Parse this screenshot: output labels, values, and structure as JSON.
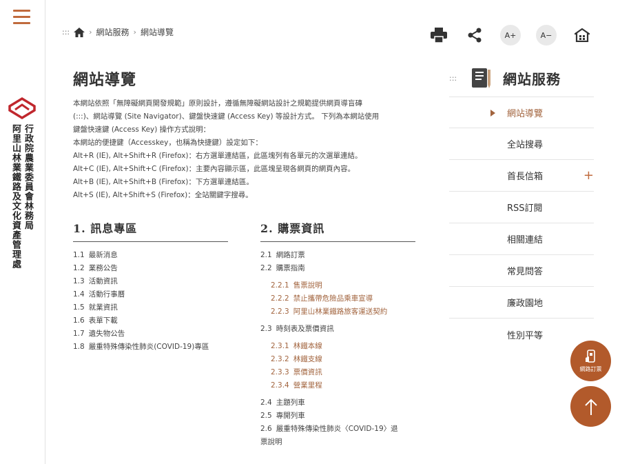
{
  "org": {
    "col1": "行政院農業委員會林務局",
    "col2": "阿里山林業鐵路及文化資產管理處"
  },
  "breadcrumb": {
    "dots": ":::",
    "items": [
      "網站服務",
      "網站導覽"
    ]
  },
  "toolbar": {
    "font_up": "A+",
    "font_down": "A−"
  },
  "page": {
    "title": "網站導覽",
    "intro": [
      "本網站依照「無障礙網頁開發規範」原則設計，遵循無障礙網站設計之規範提供網頁導盲磚",
      "(:::)、網站導覽 (Site Navigator)、鍵盤快速鍵 (Access Key) 等設計方式。 下列為本網站使用",
      "鍵盤快速鍵 (Access Key) 操作方式說明：",
      "本網站的便捷鍵（Accesskey，也稱為快捷鍵）設定如下：",
      "Alt+R (IE), Alt+Shift+R (Firefox)：右方選單連結區，此區塊列有各單元的次選單連結。",
      "Alt+C (IE), Alt+Shift+C (Firefox)：主要內容顯示區，此區塊呈現各網頁的網頁內容。",
      "Alt+B (IE), Alt+Shift+B (Firefox)：下方選單連結區。",
      "Alt+S (IE), Alt+Shift+S (Firefox)：全站關鍵字搜尋。"
    ]
  },
  "sections": [
    {
      "title": "1. 訊息專區",
      "items": [
        {
          "num": "1.1",
          "label": "最新消息"
        },
        {
          "num": "1.2",
          "label": "業務公告"
        },
        {
          "num": "1.3",
          "label": "活動資訊"
        },
        {
          "num": "1.4",
          "label": "活動行事曆"
        },
        {
          "num": "1.5",
          "label": "就業資訊"
        },
        {
          "num": "1.6",
          "label": "表單下載"
        },
        {
          "num": "1.7",
          "label": "遺失物公告"
        },
        {
          "num": "1.8",
          "label": "嚴重特殊傳染性肺炎(COVID-19)專區"
        }
      ]
    },
    {
      "title": "2. 購票資訊",
      "items": [
        {
          "num": "2.1",
          "label": "網路訂票"
        },
        {
          "num": "2.2",
          "label": "購票指南"
        },
        {
          "num": "2.2.1",
          "label": "售票說明"
        },
        {
          "num": "2.2.2",
          "label": "禁止攜帶危險品乘車宣導"
        },
        {
          "num": "2.2.3",
          "label": "阿里山林業鐵路旅客運送契約"
        },
        {
          "num": "2.3",
          "label": "時刻表及票價資訊"
        },
        {
          "num": "2.3.1",
          "label": "林鐵本線"
        },
        {
          "num": "2.3.2",
          "label": "林鐵支線"
        },
        {
          "num": "2.3.3",
          "label": "票價資訊"
        },
        {
          "num": "2.3.4",
          "label": "營業里程"
        },
        {
          "num": "2.4",
          "label": "主題列車"
        },
        {
          "num": "2.5",
          "label": "專開列車"
        },
        {
          "num": "2.6",
          "label": "嚴重特殊傳染性肺炎〈COVID-19〉退"
        },
        {
          "num": "",
          "label": "票說明"
        }
      ]
    }
  ],
  "side": {
    "dots": ":::",
    "title": "網站服務",
    "items": [
      "網站導覽",
      "全站搜尋",
      "首長信箱",
      "RSS訂閱",
      "相關連結",
      "常見問答",
      "廉政園地",
      "性別平等"
    ],
    "plus": "+"
  },
  "fab": {
    "ticket_label": "網路訂票"
  },
  "colors": {
    "accent": "#c06a3d",
    "link_brown": "#a2643e",
    "fab": "#b25a2b"
  }
}
